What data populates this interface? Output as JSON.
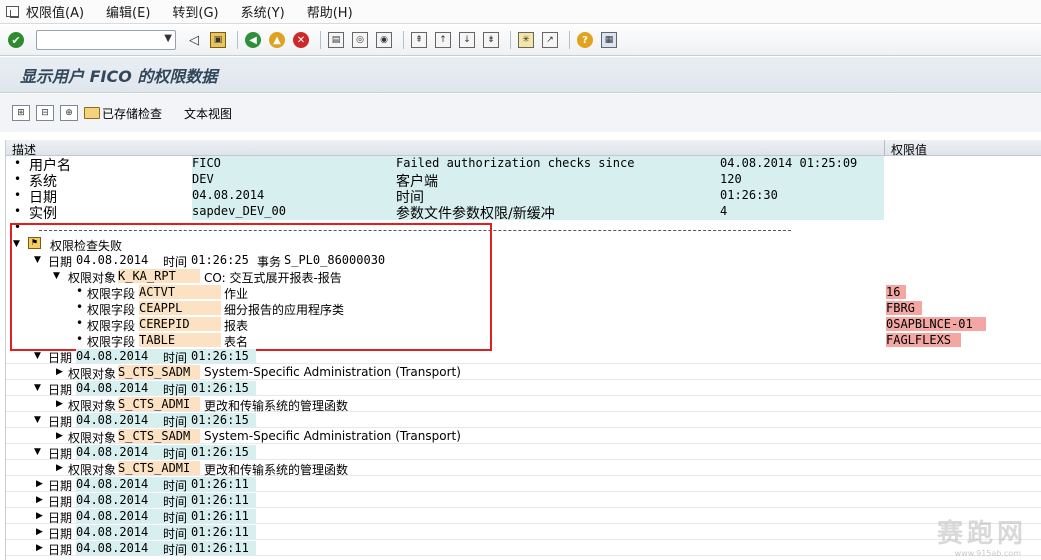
{
  "menu": [
    "权限值(A)",
    "编辑(E)",
    "转到(G)",
    "系统(Y)",
    "帮助(H)"
  ],
  "title": "显示用户 FICO 的权限数据",
  "app_toolbar": {
    "saved_check": "已存储检查",
    "text_view": "文本视图"
  },
  "columns": {
    "desc": "描述",
    "value": "权限值"
  },
  "info": [
    {
      "label": "用户名",
      "v1": "FICO",
      "k2": "Failed authorization checks since",
      "v2": "04.08.2014 01:25:09"
    },
    {
      "label": "系统",
      "v1": "DEV",
      "k2": "客户端",
      "v2": "120"
    },
    {
      "label": "日期",
      "v1": "04.08.2014",
      "k2": "时间",
      "v2": "01:26:30"
    },
    {
      "label": "实例",
      "v1": "sapdev_DEV_00",
      "k2": "参数文件参数权限/新缓冲",
      "v2": "4"
    }
  ],
  "failed_node": "权限检查失败",
  "first_entry": {
    "date_label": "日期",
    "date": "04.08.2014",
    "time_label": "时间",
    "time": "01:26:25",
    "tx_label": "事务",
    "tx": "S_PL0_86000030",
    "obj_label": "权限对象",
    "obj": "K_KA_RPT",
    "obj_desc": "CO: 交互式展开报表-报告",
    "fields": [
      {
        "prefix": "权限字段",
        "name": "ACTVT",
        "desc": "作业",
        "value": "16"
      },
      {
        "prefix": "权限字段",
        "name": "CEAPPL",
        "desc": "细分报告的应用程序类",
        "value": "FBRG"
      },
      {
        "prefix": "权限字段",
        "name": "CEREPID",
        "desc": "报表",
        "value": "0SAPBLNCE-01"
      },
      {
        "prefix": "权限字段",
        "name": "TABLE",
        "desc": "表名",
        "value": "FAGLFLEXS"
      }
    ]
  },
  "entries": [
    {
      "date": "04.08.2014",
      "time": "01:26:15",
      "obj": "S_CTS_SADM",
      "obj_desc": "System-Specific Administration (Transport)"
    },
    {
      "date": "04.08.2014",
      "time": "01:26:15",
      "obj": "S_CTS_ADMI",
      "obj_desc": "更改和传输系统的管理函数"
    },
    {
      "date": "04.08.2014",
      "time": "01:26:15",
      "obj": "S_CTS_SADM",
      "obj_desc": "System-Specific Administration (Transport)"
    },
    {
      "date": "04.08.2014",
      "time": "01:26:15",
      "obj": "S_CTS_ADMI",
      "obj_desc": "更改和传输系统的管理函数"
    }
  ],
  "collapsed": [
    {
      "date": "04.08.2014",
      "time": "01:26:11"
    },
    {
      "date": "04.08.2014",
      "time": "01:26:11"
    },
    {
      "date": "04.08.2014",
      "time": "01:26:11"
    },
    {
      "date": "04.08.2014",
      "time": "01:26:11"
    },
    {
      "date": "04.08.2014",
      "time": "01:26:11"
    }
  ],
  "labels": {
    "date": "日期",
    "time": "时间",
    "obj": "权限对象"
  },
  "watermark": {
    "text": "赛跑网",
    "url": "www.915ab.com"
  }
}
